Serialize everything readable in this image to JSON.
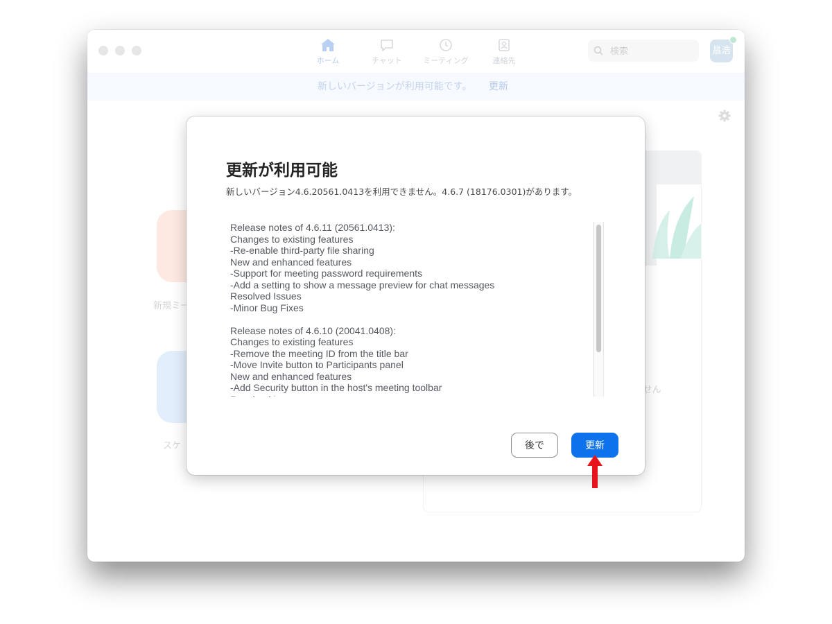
{
  "window": {
    "nav": {
      "tabs": [
        {
          "label": "ホーム",
          "icon": "home-icon",
          "active": true
        },
        {
          "label": "チャット",
          "icon": "chat-icon",
          "active": false
        },
        {
          "label": "ミーティング",
          "icon": "clock-icon",
          "active": false
        },
        {
          "label": "連絡先",
          "icon": "contacts-icon",
          "active": false
        }
      ]
    },
    "search": {
      "placeholder": "検索"
    },
    "avatar": {
      "initials": "昌浩"
    },
    "banner": {
      "message": "新しいバージョンが利用可能です。",
      "link": "更新"
    },
    "home": {
      "tile_labels": [
        "新規ミー",
        "スケ"
      ],
      "empty_text": "ません"
    }
  },
  "dialog": {
    "title": "更新が利用可能",
    "subtitle": "新しいバージョン4.6.20561.0413を利用できません。4.6.7 (18176.0301)があります。",
    "release_notes": [
      "Release notes of 4.6.11 (20561.0413):",
      "Changes to existing features",
      "-Re-enable third-party file sharing",
      "New and enhanced features",
      "-Support for meeting password requirements",
      "-Add a setting to show a message preview for chat messages",
      "Resolved Issues",
      "-Minor Bug Fixes",
      "",
      "Release notes of 4.6.10 (20041.0408):",
      "Changes to existing features",
      "-Remove the meeting ID from the title bar",
      "-Move Invite button to Participants panel",
      "New and enhanced features",
      "-Add Security button in the host's meeting toolbar",
      "Resolved Issues"
    ],
    "buttons": {
      "later": "後で",
      "update": "更新"
    }
  },
  "colors": {
    "primary_button": "#0e72ed",
    "annotation_arrow": "#e8141b"
  }
}
